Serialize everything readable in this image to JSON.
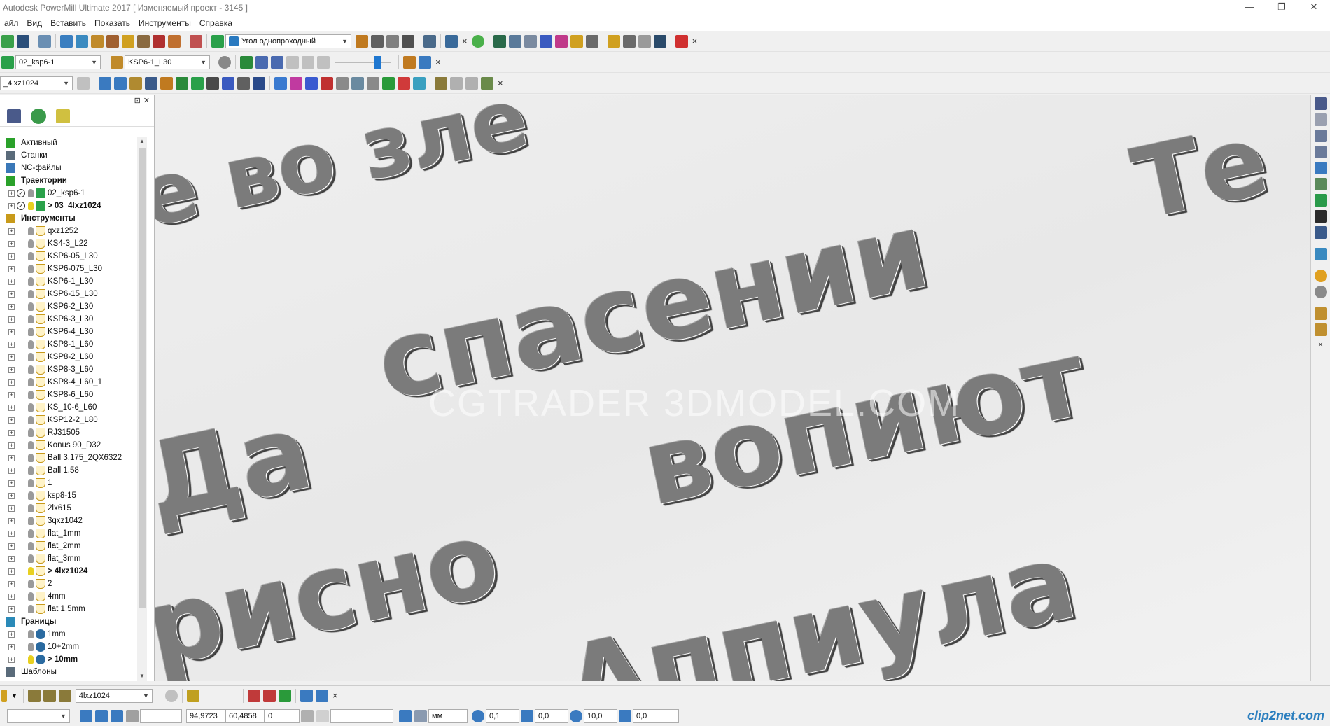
{
  "window": {
    "title": "Autodesk PowerMill Ultimate 2017   [ Изменяемый проект - 3145 ]",
    "minimize": "—",
    "maximize": "❐",
    "close": "✕"
  },
  "menu": [
    "айл",
    "Вид",
    "Вставить",
    "Показать",
    "Инструменты",
    "Справка"
  ],
  "toolbar1": {
    "strategy_combo": "Угол однопроходный",
    "close": "×"
  },
  "toolbar2": {
    "toolpath_combo": "02_ksp6-1",
    "tool_combo": "KSP6-1_L30",
    "playback_value": 0.75,
    "close": "×"
  },
  "toolbar3": {
    "tool_combo": "_4lxz1024"
  },
  "explorer": {
    "pin": "⊡",
    "close": "✕"
  },
  "tree": [
    {
      "label": "Активный",
      "level": 0,
      "icon": "active-icon",
      "color": "#2aa12a"
    },
    {
      "label": "Станки",
      "level": 0,
      "icon": "machine-icon",
      "color": "#5a6b7a"
    },
    {
      "label": "NC-файлы",
      "level": 0,
      "icon": "nc-file-icon",
      "color": "#3a78b8"
    },
    {
      "label": "Траектории",
      "level": 0,
      "icon": "toolpath-icon",
      "color": "#2aa12a",
      "bold": true,
      "expanded": true
    },
    {
      "label": "02_ksp6-1",
      "level": 1,
      "icon": "toolpath-item-icon",
      "color": "#2aa12a",
      "check": true
    },
    {
      "label": "> 03_4lxz1024",
      "level": 1,
      "icon": "toolpath-item-icon",
      "color": "#2aa12a",
      "check": true,
      "bold": true,
      "lit": true
    },
    {
      "label": "Инструменты",
      "level": 0,
      "icon": "tools-icon",
      "color": "#c89a1a",
      "bold": true,
      "expanded": true
    },
    {
      "label": "qxz1252",
      "level": 1,
      "icon": "tool-icon"
    },
    {
      "label": "KS4-3_L22",
      "level": 1,
      "icon": "tool-icon"
    },
    {
      "label": "KSP6-05_L30",
      "level": 1,
      "icon": "tool-icon"
    },
    {
      "label": "KSP6-075_L30",
      "level": 1,
      "icon": "tool-icon"
    },
    {
      "label": "KSP6-1_L30",
      "level": 1,
      "icon": "tool-icon"
    },
    {
      "label": "KSP6-15_L30",
      "level": 1,
      "icon": "tool-icon"
    },
    {
      "label": "KSP6-2_L30",
      "level": 1,
      "icon": "tool-icon"
    },
    {
      "label": "KSP6-3_L30",
      "level": 1,
      "icon": "tool-icon"
    },
    {
      "label": "KSP6-4_L30",
      "level": 1,
      "icon": "tool-icon"
    },
    {
      "label": "KSP8-1_L60",
      "level": 1,
      "icon": "tool-icon"
    },
    {
      "label": "KSP8-2_L60",
      "level": 1,
      "icon": "tool-icon"
    },
    {
      "label": "KSP8-3_L60",
      "level": 1,
      "icon": "tool-icon"
    },
    {
      "label": "KSP8-4_L60_1",
      "level": 1,
      "icon": "tool-icon"
    },
    {
      "label": "KSP8-6_L60",
      "level": 1,
      "icon": "tool-icon"
    },
    {
      "label": "KS_10-6_L60",
      "level": 1,
      "icon": "tool-icon"
    },
    {
      "label": "KSP12-2_L80",
      "level": 1,
      "icon": "tool-icon"
    },
    {
      "label": "RJ31505",
      "level": 1,
      "icon": "tool-icon"
    },
    {
      "label": "Konus 90_D32",
      "level": 1,
      "icon": "tool-icon"
    },
    {
      "label": "Ball 3,175_2QX6322",
      "level": 1,
      "icon": "tool-icon"
    },
    {
      "label": "Ball 1.58",
      "level": 1,
      "icon": "tool-icon"
    },
    {
      "label": "1",
      "level": 1,
      "icon": "tool-icon"
    },
    {
      "label": "ksp8-15",
      "level": 1,
      "icon": "tool-icon"
    },
    {
      "label": "2lx615",
      "level": 1,
      "icon": "tool-icon"
    },
    {
      "label": "3qxz1042",
      "level": 1,
      "icon": "tool-icon"
    },
    {
      "label": "flat_1mm",
      "level": 1,
      "icon": "tool-icon"
    },
    {
      "label": "flat_2mm",
      "level": 1,
      "icon": "tool-icon"
    },
    {
      "label": "flat_3mm",
      "level": 1,
      "icon": "tool-icon"
    },
    {
      "label": "> 4lxz1024",
      "level": 1,
      "icon": "tool-icon",
      "bold": true,
      "lit": true
    },
    {
      "label": "2",
      "level": 1,
      "icon": "tool-icon"
    },
    {
      "label": "4mm",
      "level": 1,
      "icon": "tool-icon"
    },
    {
      "label": "flat 1,5mm",
      "level": 1,
      "icon": "tool-icon"
    },
    {
      "label": "Границы",
      "level": 0,
      "icon": "boundary-icon",
      "color": "#2a8ab8",
      "bold": true,
      "expanded": true
    },
    {
      "label": "1mm",
      "level": 1,
      "icon": "boundary-item-icon"
    },
    {
      "label": "10+2mm",
      "level": 1,
      "icon": "boundary-item-icon"
    },
    {
      "label": "> 10mm",
      "level": 1,
      "icon": "boundary-item-icon",
      "bold": true,
      "lit": true
    },
    {
      "label": "Шаблоны",
      "level": 0,
      "icon": "pattern-icon",
      "color": "#5a6b7a"
    }
  ],
  "viewport": {
    "words": [
      "е во зле",
      "Те",
      "спасении",
      "Да",
      "вопиют",
      "рисно",
      "Аппиула"
    ],
    "watermark": "CGTRADER 3DMODEL.COM"
  },
  "bottom1": {
    "tool_combo": "4lxz1024",
    "close": "×"
  },
  "bottom2": {
    "x": "94,9723",
    "y": "60,4858",
    "z": "0",
    "units": "мм",
    "tolerance": "0,1",
    "thickness": "0,0",
    "diameter": "10,0",
    "angle": "0,0"
  },
  "brand": "clip2net.com"
}
